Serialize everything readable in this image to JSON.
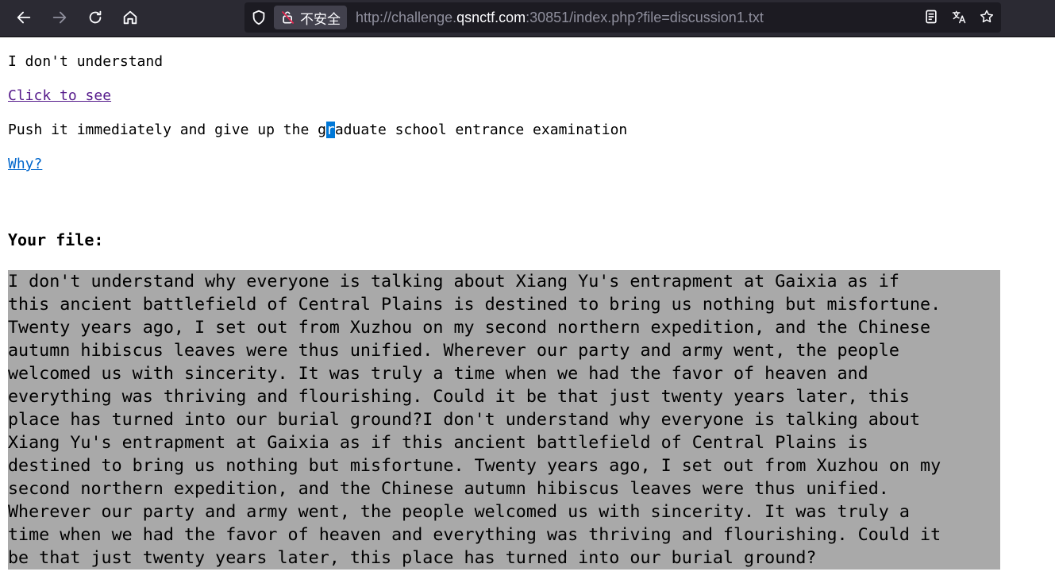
{
  "browser": {
    "url_prefix": "http://challenge.",
    "url_host": "qsnctf.com",
    "url_rest": ":30851/index.php?file=discussion1.txt",
    "insecure_label": "不安全",
    "icons": [
      "back-icon",
      "forward-icon",
      "reload-icon",
      "home-icon",
      "shield-icon",
      "insecure-lock-icon",
      "reader-view-icon",
      "translate-icon",
      "bookmark-star-icon"
    ]
  },
  "page": {
    "line1": "I don't understand",
    "link1": "Click to see",
    "line2_pre": "Push it immediately and give up the g",
    "line2_sel": "r",
    "line2_post": "aduate school entrance examination",
    "link2": "Why?",
    "heading": "Your file:",
    "file_lines": [
      "I don't understand why everyone is talking about Xiang Yu's entrapment at Gaixia as if",
      "this ancient battlefield of Central Plains is destined to bring us nothing but misfortune.",
      "Twenty years ago, I set out from Xuzhou on my second northern expedition, and the Chinese",
      "autumn hibiscus leaves were thus unified. Wherever our party and army went, the people",
      "welcomed us with sincerity. It was truly a time when we had the favor of heaven and",
      "everything was thriving and flourishing. Could it be that just twenty years later, this",
      "place has turned into our burial ground?I don't understand why everyone is talking about",
      "Xiang Yu's entrapment at Gaixia as if this ancient battlefield of Central Plains is",
      "destined to bring us nothing but misfortune. Twenty years ago, I set out from Xuzhou on my",
      "second northern expedition, and the Chinese autumn hibiscus leaves were thus unified.",
      "Wherever our party and army went, the people welcomed us with sincerity. It was truly a",
      "time when we had the favor of heaven and everything was thriving and flourishing. Could it",
      "be that just twenty years later, this place has turned into our burial ground?"
    ]
  },
  "colors": {
    "toolbar_bg": "#2b2a33",
    "urlbar_bg": "#1c1b22",
    "visited_link": "#551a8b",
    "link": "#0066cc",
    "selection": "#0078d7",
    "file_bg": "#a9a9a9"
  }
}
